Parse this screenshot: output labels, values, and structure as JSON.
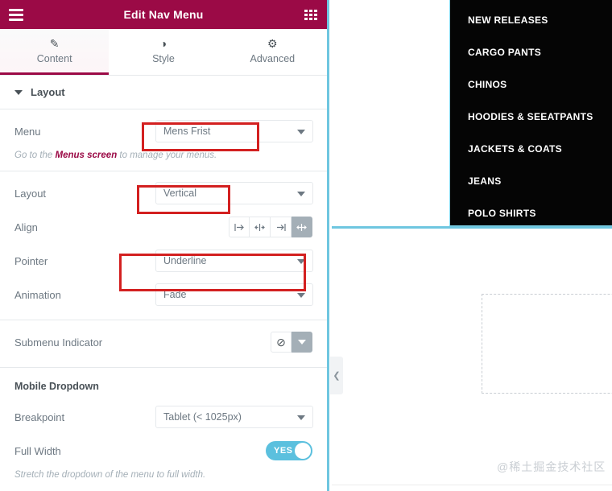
{
  "panel": {
    "header": {
      "title": "Edit Nav Menu",
      "menu_icon": "hamburger-icon",
      "grid_icon": "grid-icon"
    },
    "tabs": [
      {
        "label": "Content",
        "icon": "pencil-icon",
        "active": true
      },
      {
        "label": "Style",
        "icon": "contrast-icon",
        "active": false
      },
      {
        "label": "Advanced",
        "icon": "gear-icon",
        "active": false
      }
    ],
    "layout_section": {
      "title": "Layout",
      "menu": {
        "label": "Menu",
        "value": "Mens Frist",
        "hint_before": "Go to the ",
        "hint_link": "Menus screen",
        "hint_after": " to manage your menus."
      },
      "layout": {
        "label": "Layout",
        "value": "Vertical"
      },
      "align": {
        "label": "Align",
        "options": [
          "align-left",
          "align-center",
          "align-right",
          "align-justify"
        ],
        "selected": "align-justify"
      },
      "pointer": {
        "label": "Pointer",
        "value": "Underline"
      },
      "animation": {
        "label": "Animation",
        "value": "Fade"
      }
    },
    "submenu_indicator": {
      "label": "Submenu Indicator",
      "value_icon": "none-circle-slash-icon"
    },
    "mobile_dropdown": {
      "title": "Mobile Dropdown",
      "breakpoint": {
        "label": "Breakpoint",
        "value": "Tablet (< 1025px)"
      },
      "full_width": {
        "label": "Full Width",
        "value": "YES",
        "hint": "Stretch the dropdown of the menu to full width."
      }
    }
  },
  "preview": {
    "nav_items": [
      "NEW RELEASES",
      "CARGO PANTS",
      "CHINOS",
      "HOODIES & SEEATPANTS",
      "JACKETS & COATS",
      "JEANS",
      "POLO SHIRTS"
    ],
    "watermark": "@稀土掘金技术社区",
    "collapse_handle_icon": "chevron-left-icon"
  },
  "colors": {
    "brand": "#9b0a46",
    "accent_teal": "#6ec6e0",
    "annotation_red": "#d32020",
    "toggle_on": "#5bc0de"
  }
}
